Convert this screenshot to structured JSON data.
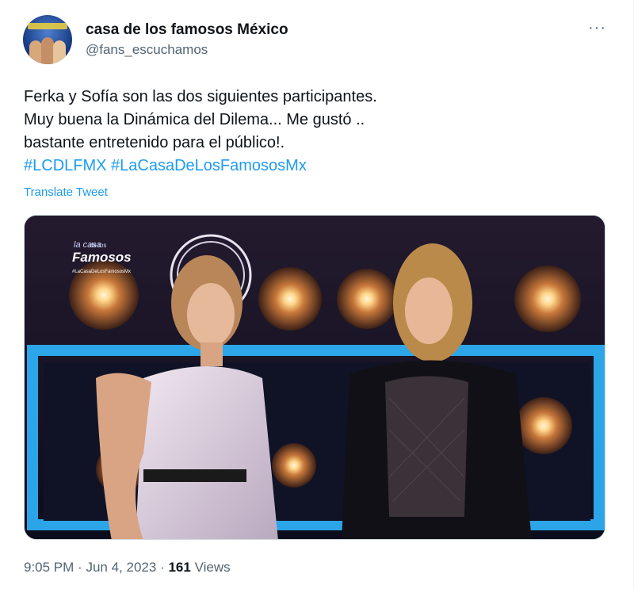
{
  "tweet": {
    "display_name": "casa de los famosos México",
    "handle": "@fans_escuchamos",
    "more_label": "···",
    "lines": [
      "Ferka y Sofía son las dos siguientes participantes.",
      "Muy buena la Dinámica del Dilema... Me gustó ..",
      "bastante entretenido para el público!."
    ],
    "hashtags": [
      "#LCDLFMX",
      "#LaCasaDeLosFamososMx"
    ],
    "translate_label": "Translate Tweet",
    "media": {
      "logo_line1": "la casa",
      "logo_line2": "de los",
      "logo_line3": "Famosos",
      "logo_hashtag": "#LaCasaDeLosFamososMx"
    },
    "time": "9:05 PM",
    "date": "Jun 4, 2023",
    "views_count": "161",
    "views_label": "Views",
    "separator": "·"
  },
  "colors": {
    "accent": "#1d9bf0",
    "text": "#0f1419",
    "muted": "#536471"
  }
}
